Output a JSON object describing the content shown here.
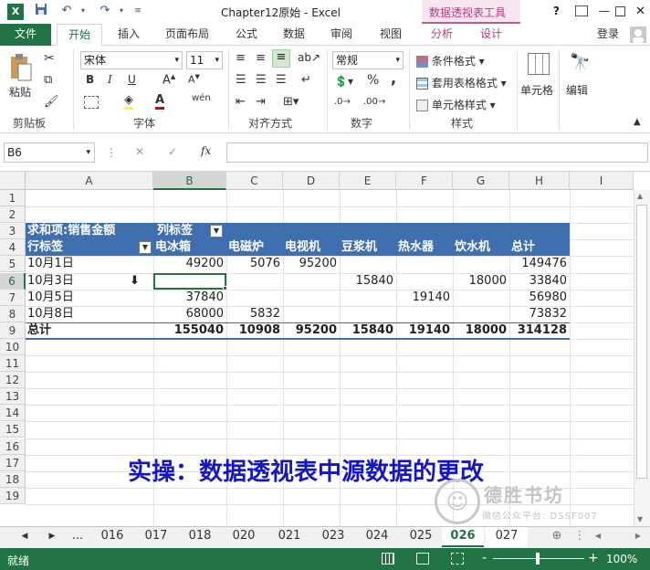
{
  "title": {
    "doc": "Chapter12原始 - Excel",
    "context_tab": "数据透视表工具",
    "help": "?",
    "login": "登录"
  },
  "tabs": [
    "文件",
    "开始",
    "插入",
    "页面布局",
    "公式",
    "数据",
    "审阅",
    "视图",
    "分析",
    "设计"
  ],
  "ribbon": {
    "paste": "粘贴",
    "font_name": "宋体",
    "font_size": "11",
    "bold": "B",
    "italic": "I",
    "underline": "U",
    "wen": "wén",
    "number_format": "常规",
    "percent": "%",
    "comma": ",",
    "cond_format": "条件格式",
    "table_format": "套用表格格式",
    "cell_style": "单元格样式",
    "cells": "单元格",
    "editing": "编辑",
    "groups": [
      "剪贴板",
      "字体",
      "对齐方式",
      "数字",
      "样式"
    ]
  },
  "formula_bar": {
    "name_box": "B6",
    "fx": "fx",
    "cancel": "✕",
    "enter": "✓",
    "value": ""
  },
  "columns": [
    "A",
    "B",
    "C",
    "D",
    "E",
    "F",
    "G",
    "H",
    "I"
  ],
  "rows": [
    "1",
    "2",
    "3",
    "4",
    "5",
    "6",
    "7",
    "8",
    "9",
    "10",
    "11",
    "12",
    "13",
    "14",
    "15",
    "16",
    "17",
    "18",
    "19"
  ],
  "pivot": {
    "sum_label": "求和项:销售金额",
    "col_label": "列标签",
    "row_label": "行标签",
    "headers": [
      "电冰箱",
      "电磁炉",
      "电视机",
      "豆浆机",
      "热水器",
      "饮水机",
      "总计"
    ],
    "data": [
      {
        "label": "10月1日",
        "values": [
          "49200",
          "5076",
          "95200",
          "",
          "",
          "",
          "149476"
        ]
      },
      {
        "label": "10月3日",
        "values": [
          "",
          "",
          "",
          "15840",
          "",
          "18000",
          "33840"
        ]
      },
      {
        "label": "10月5日",
        "values": [
          "37840",
          "",
          "",
          "",
          "19140",
          "",
          "56980"
        ]
      },
      {
        "label": "10月8日",
        "values": [
          "68000",
          "5832",
          "",
          "",
          "",
          "",
          "73832"
        ]
      }
    ],
    "total_label": "总计",
    "totals": [
      "155040",
      "10908",
      "95200",
      "15840",
      "19140",
      "18000",
      "314128"
    ]
  },
  "banner": "实操：数据透视表中源数据的更改",
  "watermark": {
    "name": "德胜书坊",
    "sub": "微信公众平台: DSSF007"
  },
  "sheets": [
    "...",
    "016",
    "017",
    "018",
    "020",
    "021",
    "023",
    "024",
    "025",
    "026",
    "027"
  ],
  "status": {
    "ready": "就绪",
    "zoom": "100%",
    "minus": "-",
    "plus": "+"
  }
}
